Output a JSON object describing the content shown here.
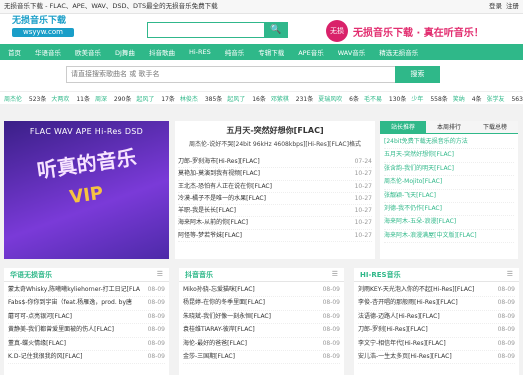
{
  "topbar": {
    "notice": "无损音乐下载 - FLAC、APE、WAV、DSD、DTS最全的无损音乐免费下载",
    "login": "登录",
    "register": "注册"
  },
  "logo": {
    "line1": "无损音乐下载",
    "line2": "wsyyw.com"
  },
  "search_top": {
    "button": "🔍"
  },
  "brand": {
    "circle": "无损",
    "text": "无损音乐下载 · 真在听音乐！"
  },
  "nav": [
    "首页",
    "华语音乐",
    "欧美音乐",
    "DJ舞曲",
    "抖音歌曲",
    "Hi-RES",
    "纯音乐",
    "专辑下载",
    "APE音乐",
    "WAV音乐",
    "精选无损音乐"
  ],
  "search": {
    "placeholder": "请直接搜索歌曲名 或 歌手名",
    "button": "搜索"
  },
  "tags": [
    [
      "周杰伦",
      "523条"
    ],
    [
      "大两欢",
      "11条"
    ],
    [
      "周深",
      "290条"
    ],
    [
      "起风了",
      "17条"
    ],
    [
      "林俊杰",
      "385条"
    ],
    [
      "起风了",
      "16条"
    ],
    [
      "邓紫棋",
      "231条"
    ],
    [
      "夏瑞风吹",
      "6条"
    ],
    [
      "毛不易",
      "130条"
    ],
    [
      "少年",
      "558条"
    ],
    [
      "笑纳",
      "4条"
    ],
    [
      "张学友",
      "563条"
    ]
  ],
  "banner": {
    "line1": "FLAC WAV APE Hi-Res DSD",
    "line2": "听真的音乐",
    "line3": "VIP"
  },
  "featured": {
    "title": "五月天-突然好想你[FLAC]",
    "subtitle": "周杰伦-说好不哭[24bit 96kHz 4608kbps][Hi-Res][FLAC]格式",
    "items": [
      [
        "刀郎-罗刹海市[Hi-Res][FLAC]",
        "07-24"
      ],
      [
        "莫艳加-莫演到我有视频[FLAC]",
        "10-27"
      ],
      [
        "王北杰-恐怕有人正在说在你[FLAC]",
        "10-27"
      ],
      [
        "冷漠-橘子不是唯一的水果[FLAC]",
        "10-27"
      ],
      [
        "羊职-我是长长[FLAC]",
        "10-27"
      ],
      [
        "海来阿木-从前的你[FLAC]",
        "10-27"
      ],
      [
        "阿怪等-梦若爷妹[FLAC]",
        "10-27"
      ]
    ]
  },
  "right": {
    "tabs": [
      "站长推荐",
      "本周排行",
      "下载总榜"
    ],
    "items": [
      "[24bit免费下载无损音乐的方法",
      "五月天-突然好想你[FLAC]",
      "张含韵-我们的明天[FLAC]",
      "周杰伦-Mojito[FLAC]",
      "张靓颖-飞天[FLAC]",
      "刘德-我不仍作[FLAC]",
      "海来阿木-五朵-浪漫[FLAC]",
      "海来阿木-浪漫满屋[中文版][FLAC]"
    ]
  },
  "col1": {
    "title": "华语无损音乐",
    "items": [
      [
        "蒙太奇Whisky,陈曦曦kyliehorner-打工日记[FLA",
        "08-09"
      ],
      [
        "Fabs$-你你到宇宙（feat.杨雁逸，prod. by唐",
        "08-09"
      ],
      [
        "蘑可可-点亮银河[FLAC]",
        "08-09"
      ],
      [
        "黄静美-我们都曾爱里面被的伤人[FLAC]",
        "08-09"
      ],
      [
        "董真-蝶火情缘[FLAC]",
        "08-09"
      ],
      [
        "K.D-记住我很我的风[FLAC]",
        "08-09"
      ]
    ]
  },
  "col2": {
    "title": "抖音音乐",
    "items": [
      [
        "Miko孙骁-忘爱猫咪[FLAC]",
        "08-09"
      ],
      [
        "杨昆婷-在你的冬季里面[FLAC]",
        "08-09"
      ],
      [
        "朱晓斌-我们好像一刻永恒[FLAC]",
        "08-09"
      ],
      [
        "袁桂维TiARAY-彼岸[FLAC]",
        "08-09"
      ],
      [
        "海伦-最好的爸爸[FLAC]",
        "08-09"
      ],
      [
        "金莎-三国期[FLAC]",
        "08-09"
      ]
    ]
  },
  "col3": {
    "title": "HI-RES音乐",
    "items": [
      [
        "刘雨KEY-天光泡入你的不起[Hi-Res][FLAC]",
        "08-09"
      ],
      [
        "李俊-杏开唱的那般雨[Hi-Res][FLAC]",
        "08-09"
      ],
      [
        "法语德-迈路人[Hi-Res][FLAC]",
        "08-09"
      ],
      [
        "刀郎-罗刹[Hi-Res][FLAC]",
        "08-09"
      ],
      [
        "李文宁-相信年代[Hi-Res][FLAC]",
        "08-09"
      ],
      [
        "安儿浩-一生太多页[Hi-Res][FLAC]",
        "08-09"
      ]
    ]
  }
}
